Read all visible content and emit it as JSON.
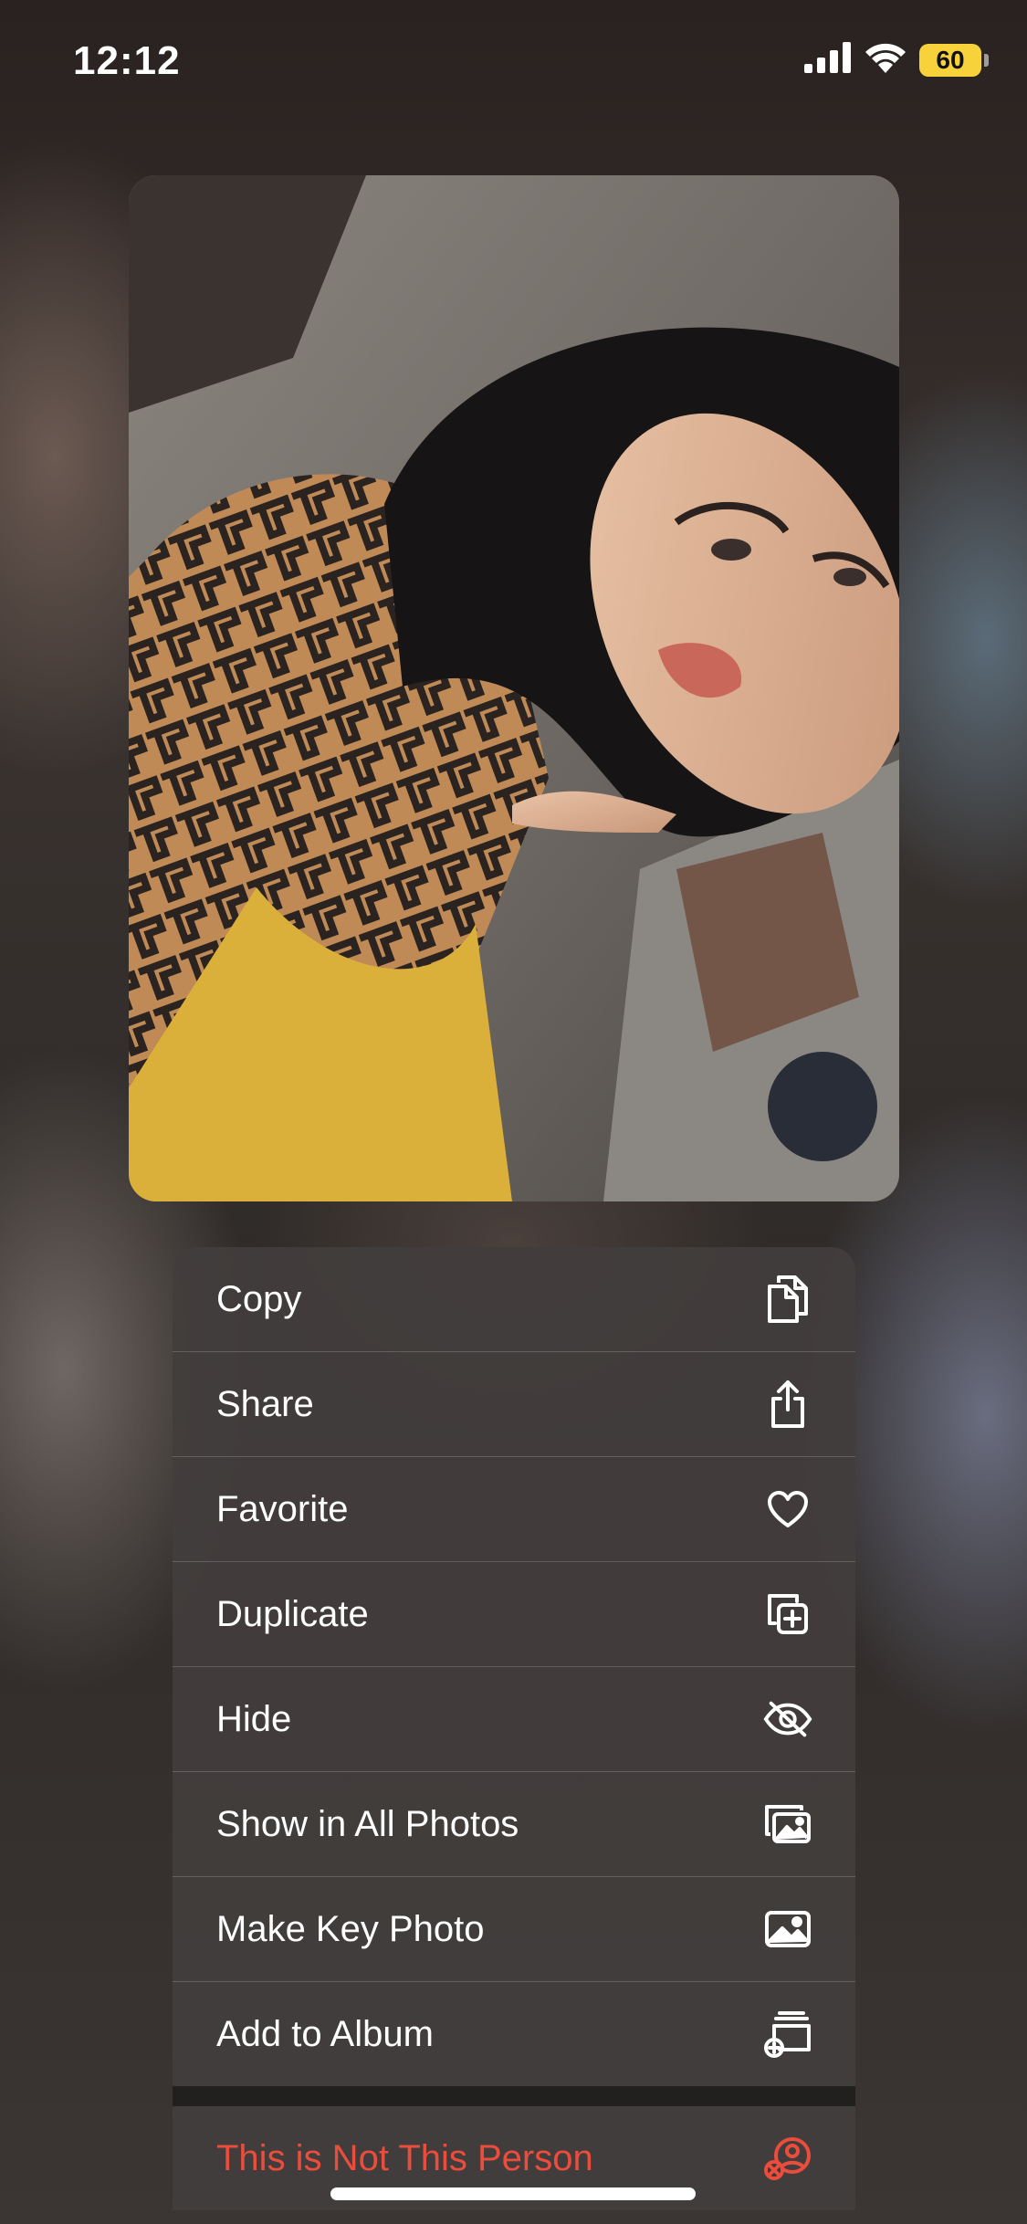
{
  "status_bar": {
    "time": "12:12",
    "battery_level": "60",
    "battery_color": "#f7d23b",
    "icons": [
      "cellular-signal-icon",
      "wifi-icon",
      "battery-icon"
    ]
  },
  "photo": {
    "description_icon": "photo-preview"
  },
  "menu": {
    "items": [
      {
        "label": "Copy",
        "icon": "copy-icon"
      },
      {
        "label": "Share",
        "icon": "share-icon"
      },
      {
        "label": "Favorite",
        "icon": "heart-icon"
      },
      {
        "label": "Duplicate",
        "icon": "duplicate-icon"
      },
      {
        "label": "Hide",
        "icon": "eye-slash-icon"
      },
      {
        "label": "Show in All Photos",
        "icon": "photos-stack-icon"
      },
      {
        "label": "Make Key Photo",
        "icon": "photo-icon"
      },
      {
        "label": "Add to Album",
        "icon": "add-to-album-icon"
      }
    ],
    "destructive": {
      "label": "This is Not This Person",
      "icon": "person-remove-icon",
      "color": "#eb4d3d"
    }
  }
}
